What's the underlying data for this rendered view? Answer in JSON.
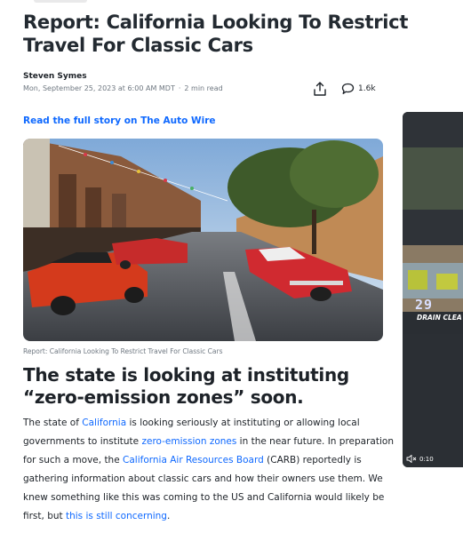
{
  "article": {
    "headline": "Report: California Looking To Restrict Travel For Classic Cars",
    "author": "Steven Symes",
    "date": "Mon, September 25, 2023 at 6:00 AM MDT",
    "read_time": "2 min read",
    "comment_count": "1.6k",
    "full_story_link": "Read the full story on The Auto Wire",
    "image_caption": "Report: California Looking To Restrict Travel For Classic Cars",
    "subheading": "The state is looking at instituting “zero-emission zones” soon.",
    "paragraph": [
      {
        "text": "The state of ",
        "link": false
      },
      {
        "text": "California",
        "link": true
      },
      {
        "text": " is looking seriously at instituting or allowing local governments to institute ",
        "link": false
      },
      {
        "text": "zero-emission zones",
        "link": true
      },
      {
        "text": " in the near future. In preparation for such a move, the ",
        "link": false
      },
      {
        "text": "California Air Resources Board",
        "link": true
      },
      {
        "text": " (CARB) reportedly is gathering information about classic cars and how their owners use them. We knew something like this was coming to the US and California would likely be first, but ",
        "link": false
      },
      {
        "text": "this is still concerning",
        "link": true
      },
      {
        "text": ".",
        "link": false
      }
    ]
  },
  "video_preview": {
    "overlay_number": "29",
    "overlay_text": "DRAIN CLEA",
    "time": "0:10",
    "mute_icon": "muted-speaker-icon"
  },
  "icons": {
    "share": "share-icon",
    "comment": "comment-bubble-icon"
  },
  "colors": {
    "link": "#0f69ff",
    "text": "#1d2228",
    "muted": "#6e7780"
  }
}
